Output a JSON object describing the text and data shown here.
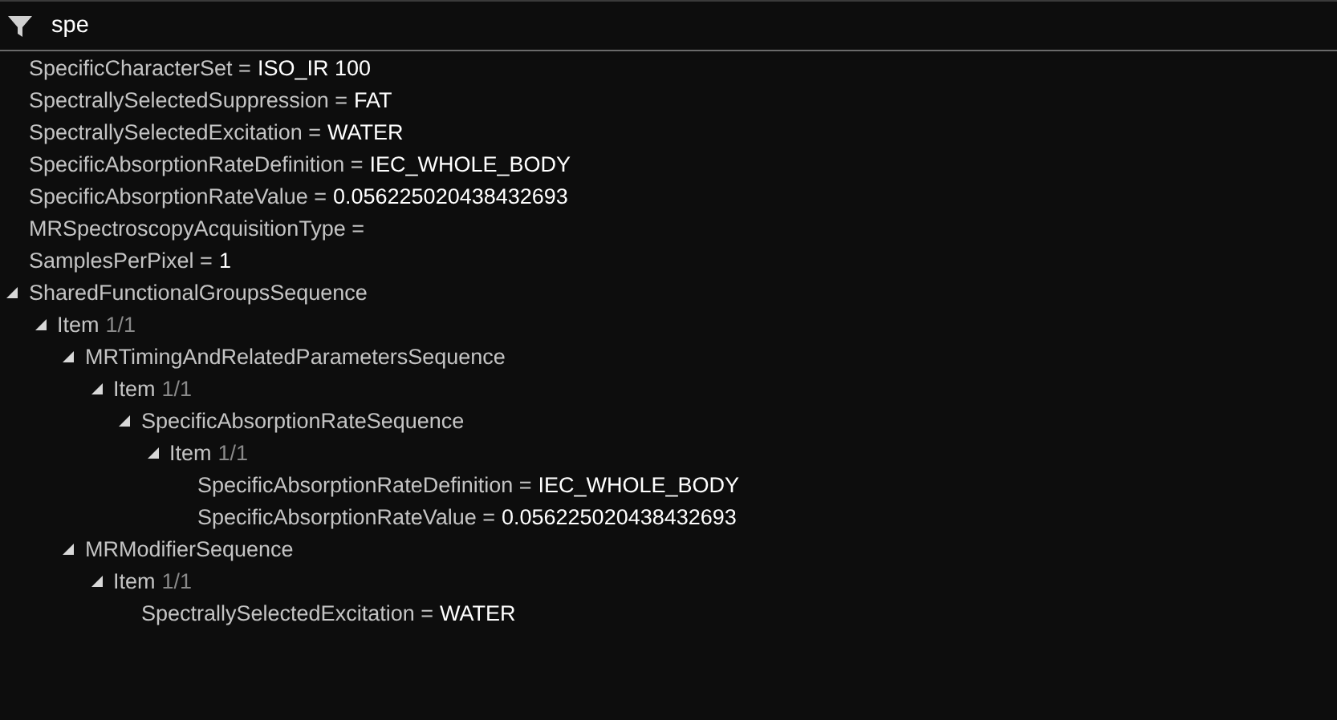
{
  "filter": {
    "value": "spe"
  },
  "tree": [
    {
      "label": "SpecificCharacterSet =",
      "value": "ISO_IR 100"
    },
    {
      "label": "SpectrallySelectedSuppression =",
      "value": "FAT"
    },
    {
      "label": "SpectrallySelectedExcitation =",
      "value": "WATER"
    },
    {
      "label": "SpecificAbsorptionRateDefinition =",
      "value": "IEC_WHOLE_BODY"
    },
    {
      "label": "SpecificAbsorptionRateValue =",
      "value": "0.056225020438432693"
    },
    {
      "label": "MRSpectroscopyAcquisitionType ="
    },
    {
      "label": "SamplesPerPixel =",
      "value": "1"
    },
    {
      "label": "SharedFunctionalGroupsSequence",
      "expanded": true,
      "children": [
        {
          "label": "Item",
          "count": "1/1",
          "expanded": true,
          "children": [
            {
              "label": "MRTimingAndRelatedParametersSequence",
              "expanded": true,
              "children": [
                {
                  "label": "Item",
                  "count": "1/1",
                  "expanded": true,
                  "children": [
                    {
                      "label": "SpecificAbsorptionRateSequence",
                      "expanded": true,
                      "children": [
                        {
                          "label": "Item",
                          "count": "1/1",
                          "expanded": true,
                          "children": [
                            {
                              "label": "SpecificAbsorptionRateDefinition =",
                              "value": "IEC_WHOLE_BODY"
                            },
                            {
                              "label": "SpecificAbsorptionRateValue =",
                              "value": "0.056225020438432693"
                            }
                          ]
                        }
                      ]
                    }
                  ]
                }
              ]
            },
            {
              "label": "MRModifierSequence",
              "expanded": true,
              "children": [
                {
                  "label": "Item",
                  "count": "1/1",
                  "expanded": true,
                  "children": [
                    {
                      "label": "SpectrallySelectedExcitation =",
                      "value": "WATER"
                    }
                  ]
                }
              ]
            }
          ]
        }
      ]
    }
  ]
}
